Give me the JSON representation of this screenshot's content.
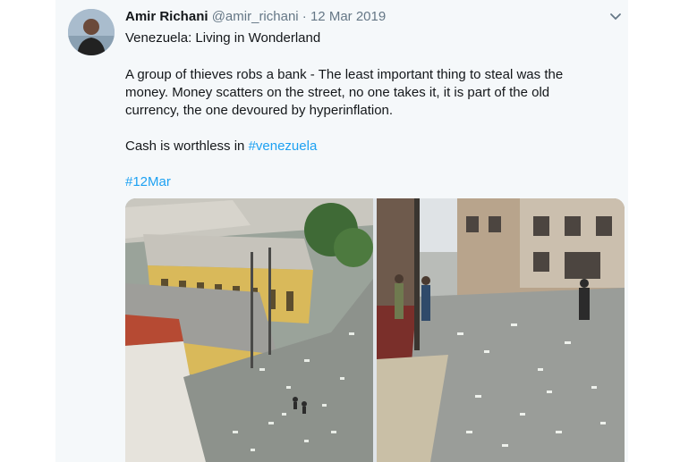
{
  "tweet": {
    "author_name": "Amir Richani",
    "author_handle": "@amir_richani",
    "separator": "·",
    "date": "12 Mar 2019",
    "line1": "Venezuela: Living in Wonderland",
    "body_lines": [
      "A group of thieves robs a bank - The least important thing to steal was the",
      "money. Money scatters on the street, no one takes it, it is part of the old",
      "currency, the one devoured by hyperinflation."
    ],
    "cash_prefix": "Cash is worthless in ",
    "cash_hashtag": "#venezuela",
    "date_hashtag": "#12Mar"
  },
  "icons": {
    "menu": "chevron-down-icon",
    "avatar": "avatar"
  },
  "colors": {
    "link": "#1da1f2",
    "muted": "#657786",
    "text": "#14171a",
    "card_bg": "#f5f8fa"
  }
}
